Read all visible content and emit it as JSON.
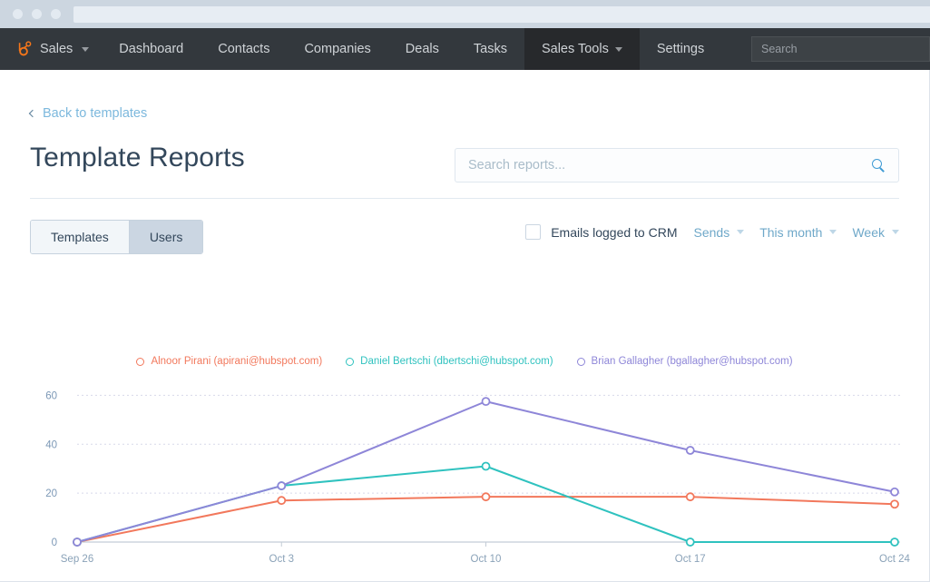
{
  "browser": {
    "dots": [
      "dot-1",
      "dot-2",
      "dot-3"
    ],
    "url_value": ""
  },
  "nav": {
    "brand": "Sales",
    "brand_icon": "hubspot-sprocket-icon",
    "items": [
      {
        "label": "Dashboard",
        "active": false,
        "has_caret": false
      },
      {
        "label": "Contacts",
        "active": false,
        "has_caret": false
      },
      {
        "label": "Companies",
        "active": false,
        "has_caret": false
      },
      {
        "label": "Deals",
        "active": false,
        "has_caret": false
      },
      {
        "label": "Tasks",
        "active": false,
        "has_caret": false
      },
      {
        "label": "Sales Tools",
        "active": true,
        "has_caret": true
      },
      {
        "label": "Settings",
        "active": false,
        "has_caret": false
      }
    ],
    "search_placeholder": "Search"
  },
  "page": {
    "back_link": "Back to templates",
    "title": "Template Reports",
    "search_placeholder": "Search reports...",
    "search_value": ""
  },
  "tabs": [
    {
      "label": "Templates",
      "selected": false
    },
    {
      "label": "Users",
      "selected": true
    }
  ],
  "filters": {
    "checkbox_label": "Emails logged to CRM",
    "checkbox_checked": false,
    "dropdowns": [
      {
        "label": "Sends"
      },
      {
        "label": "This month"
      },
      {
        "label": "Week"
      }
    ]
  },
  "colors": {
    "series_orange": "#f2785c",
    "series_teal": "#2fc2bf",
    "series_purple": "#8e86d8",
    "nav_bg": "#33383d",
    "nav_active": "#27292c",
    "brand_orange": "#f5761a",
    "link_blue": "#7cb8dd",
    "title_navy": "#33475b",
    "tab_selected": "#cbd6e2"
  },
  "chart_data": {
    "type": "line",
    "title": "",
    "xlabel": "",
    "ylabel": "",
    "categories": [
      "Sep 26",
      "Oct 3",
      "Oct 10",
      "Oct 17",
      "Oct 24"
    ],
    "yticks": [
      0,
      20,
      40,
      60
    ],
    "ylim": [
      0,
      62
    ],
    "grid": true,
    "legend_position": "top-center",
    "series": [
      {
        "name": "Alnoor Pirani (apirani@hubspot.com)",
        "color": "#f2785c",
        "values": [
          0,
          17,
          18.5,
          18.5,
          15.5
        ]
      },
      {
        "name": "Daniel Bertschi (dbertschi@hubspot.com)",
        "color": "#2fc2bf",
        "values": [
          0,
          23,
          31,
          0,
          0
        ]
      },
      {
        "name": "Brian Gallagher (bgallagher@hubspot.com)",
        "color": "#8e86d8",
        "values": [
          0,
          23,
          57.5,
          37.5,
          20.5
        ]
      }
    ]
  }
}
